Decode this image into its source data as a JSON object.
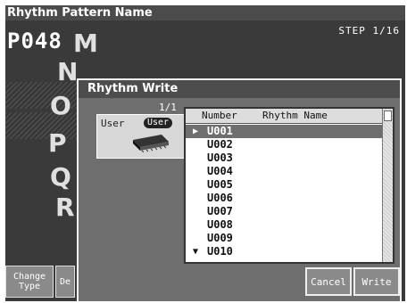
{
  "window": {
    "title": "Rhythm Pattern Name"
  },
  "header": {
    "pattern_number": "P048",
    "step": "STEP 1/16"
  },
  "background_letters": [
    "M",
    "N",
    "O",
    "P",
    "Q",
    "R"
  ],
  "softkeys": [
    {
      "label": "Change\nType"
    },
    {
      "label": "De"
    }
  ],
  "dialog": {
    "title": "Rhythm Write",
    "page": "1/1",
    "destination": {
      "label": "User",
      "badge": "User"
    },
    "list": {
      "columns": [
        "Number",
        "Rhythm Name"
      ],
      "rows": [
        "U001",
        "U002",
        "U003",
        "U004",
        "U005",
        "U006",
        "U007",
        "U008",
        "U009",
        "U010"
      ],
      "selected_index": 0
    },
    "buttons": {
      "cancel": "Cancel",
      "write": "Write"
    }
  }
}
